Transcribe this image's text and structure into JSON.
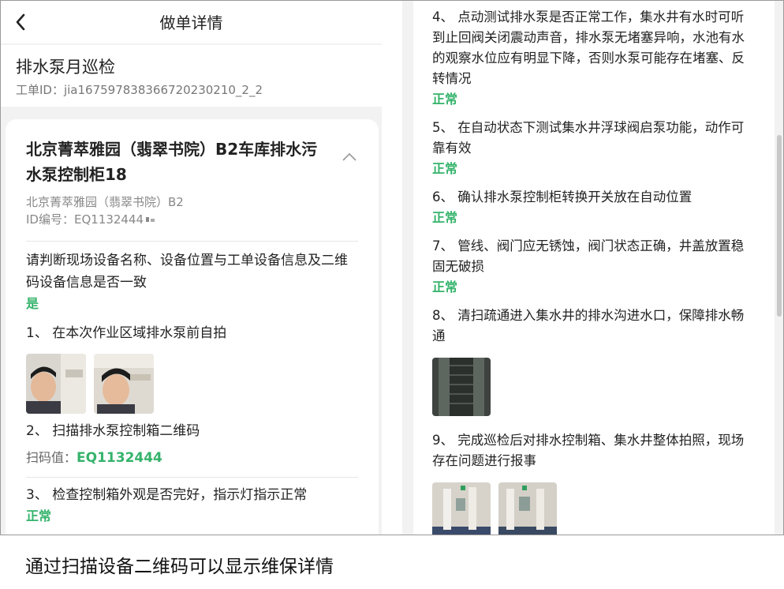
{
  "nav": {
    "title": "做单详情"
  },
  "task": {
    "title": "排水泵月巡检",
    "id": "工单ID：jia1675978383667202302​10_2_2"
  },
  "equipment": {
    "title": "北京菁萃雅园（翡翠书院）B2车库排水污水泵控制柜18",
    "location": "北京菁萃雅园（翡翠书院）B2",
    "id": "ID编号：EQ1132444"
  },
  "left_items": [
    {
      "q": "请判断现场设备名称、设备位置与工单设备信息及二维码设备信息是否一致",
      "a": "是"
    },
    {
      "q": "1、 在本次作业区域排水泵前自拍"
    },
    {
      "q": "2、 扫描排水泵控制箱二维码",
      "scan_label": "扫码值：",
      "scan_value": "EQ1132444"
    },
    {
      "q": "3、 检查控制箱外观是否完好，指示灯指示正常",
      "a": "正常"
    }
  ],
  "right_items": [
    {
      "q": "4、 点动测试排水泵是否正常工作，集水井有水时可听到止回阀关闭震动声音，排水泵无堵塞异响，水池有水的观察水位应有明显下降，否则水泵可能存在堵塞、反转情况",
      "a": "正常"
    },
    {
      "q": "5、 在自动状态下测试集水井浮球阀启泵功能，动作可靠有效",
      "a": "正常"
    },
    {
      "q": "6、 确认排水泵控制柜转换开关放在自动位置",
      "a": "正常"
    },
    {
      "q": "7、 管线、阀门应无锈蚀，阀门状态正确，井盖放置稳固无破损",
      "a": "正常"
    },
    {
      "q": "8、 清扫疏通进入集水井的排水沟进水口，保障排水畅通"
    },
    {
      "q": "9、 完成巡检后对排水控制箱、集水井整体拍照，现场存在问题进行报事"
    }
  ],
  "caption": "通过扫描设备二维码可以显示维保详情",
  "colors": {
    "accent_green": "#35b36b",
    "background": "#f2f2f2"
  },
  "icons": [
    "back-arrow-icon",
    "chevron-up-icon",
    "qr-mark-icon"
  ]
}
